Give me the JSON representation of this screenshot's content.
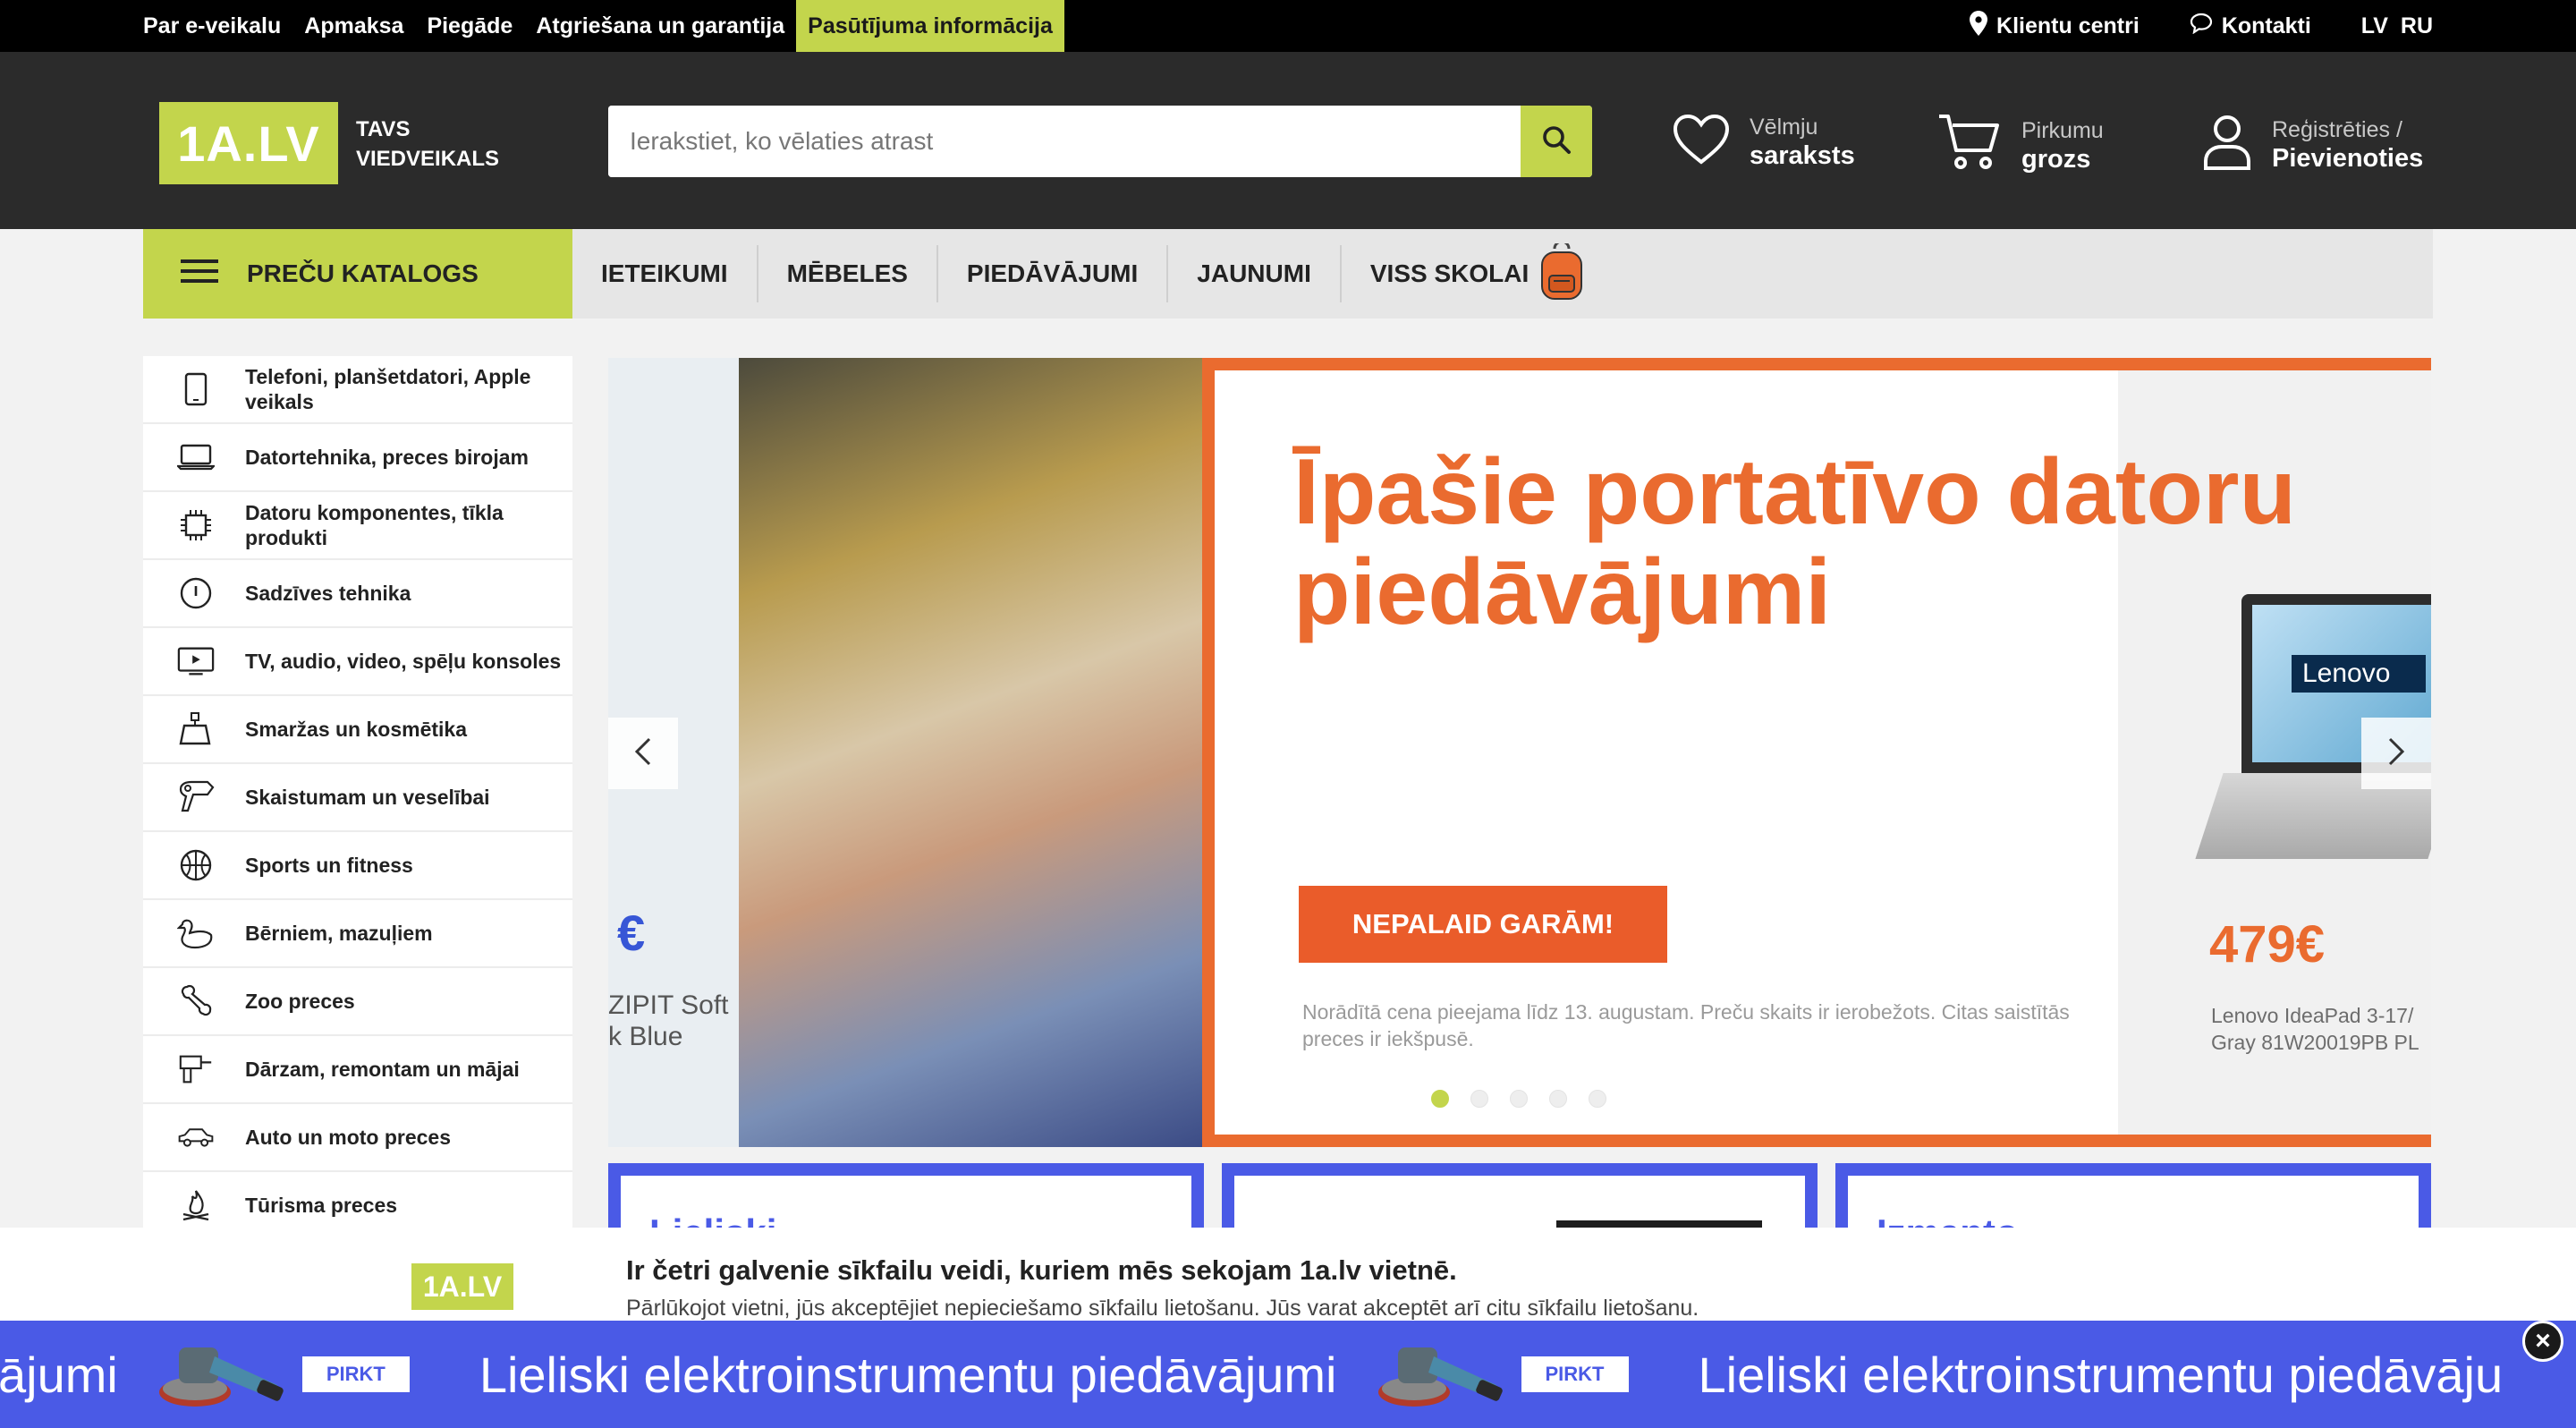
{
  "topbar": {
    "links": [
      "Par e-veikalu",
      "Apmaksa",
      "Piegāde",
      "Atgriešana un garantija",
      "Pasūtījuma informācija"
    ],
    "client_centers": "Klientu centri",
    "contacts": "Kontakti",
    "lang_lv": "LV",
    "lang_ru": "RU"
  },
  "header": {
    "logo": "1A.LV",
    "tagline_1": "TAVS",
    "tagline_2": "VIEDVEIKALS",
    "search_placeholder": "Ierakstiet, ko vēlaties atrast",
    "wishlist_1": "Vēlmju",
    "wishlist_2": "saraksts",
    "cart_1": "Pirkumu",
    "cart_2": "grozs",
    "account_1": "Reģistrēties /",
    "account_2": "Pievienoties"
  },
  "nav": {
    "catalog": "PREČU KATALOGS",
    "items": [
      "IETEIKUMI",
      "MĒBELES",
      "PIEDĀVĀJUMI",
      "JAUNUMI",
      "VISS SKOLAI"
    ]
  },
  "categories": [
    {
      "label": "Telefoni, planšetdatori, Apple veikals",
      "icon": "phone-icon"
    },
    {
      "label": "Datortehnika, preces birojam",
      "icon": "laptop-icon"
    },
    {
      "label": "Datoru komponentes, tīkla produkti",
      "icon": "chip-icon"
    },
    {
      "label": "Sadzīves tehnika",
      "icon": "power-icon"
    },
    {
      "label": "TV, audio, video, spēļu konsoles",
      "icon": "tv-icon"
    },
    {
      "label": "Smaržas un kosmētika",
      "icon": "perfume-icon"
    },
    {
      "label": "Skaistumam un veselībai",
      "icon": "hairdryer-icon"
    },
    {
      "label": "Sports un fitness",
      "icon": "basketball-icon"
    },
    {
      "label": "Bērniem, mazuļiem",
      "icon": "duck-icon"
    },
    {
      "label": "Zoo preces",
      "icon": "bone-icon"
    },
    {
      "label": "Dārzam, remontam un mājai",
      "icon": "drill-icon"
    },
    {
      "label": "Auto un moto preces",
      "icon": "car-icon"
    },
    {
      "label": "Tūrisma preces",
      "icon": "campfire-icon"
    }
  ],
  "hero": {
    "peek_price": "€",
    "peek_text_1": "ZIPIT Soft",
    "peek_text_2": "k Blue",
    "title": "Īpašie portatīvo datoru piedāvājumi",
    "cta": "NEPALAID GARĀM!",
    "note": "Norādītā cena pieejama līdz 13. augustam. Preču skaits ir ierobežots. Citas saistītās preces ir iekšpusē.",
    "laptop_brand": "Lenovo",
    "price": "479€",
    "model_1": "Lenovo IdeaPad 3-17/",
    "model_2": "Gray 81W20019PB PL",
    "active_slide": 1,
    "slide_count": 5
  },
  "cards": [
    {
      "title": "Lieliski"
    },
    {
      "title": ""
    },
    {
      "title": "Izmanto"
    }
  ],
  "cookie": {
    "logo": "1A.LV",
    "title": "Ir četri galvenie sīkfailu veidi, kuriem mēs sekojam 1a.lv vietnē.",
    "text": "Pārlūkojot vietni, jūs akceptējiet nepieciešamo sīkfailu lietošanu. Jūs varat akceptēt arī citu sīkfailu lietošanu."
  },
  "ribbon": {
    "text_partial_left": "ājumi",
    "text": "Lieliski elektroinstrumentu piedāvājumi",
    "text_partial_right": "Lieliski elektroinstrumentu piedāvāju",
    "buy": "PIRKT",
    "close": "×"
  },
  "colors": {
    "brand_green": "#c3d54c",
    "accent_orange": "#ea6b2f",
    "promo_blue": "#4a5ae6",
    "header_dark": "#2b2b2b"
  }
}
